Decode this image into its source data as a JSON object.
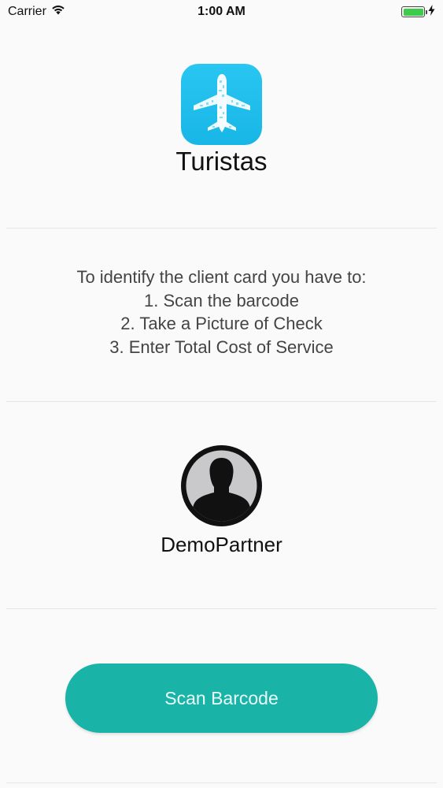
{
  "status_bar": {
    "carrier": "Carrier",
    "time": "1:00 AM"
  },
  "header": {
    "app_icon": "airplane-icon",
    "title": "Turistas"
  },
  "instructions": {
    "lines": [
      "To identify the client card you have to:",
      "1. Scan the barcode",
      "2. Take a Picture of Check",
      "3. Enter Total Cost of Service"
    ]
  },
  "partner": {
    "avatar_icon": "person-silhouette-icon",
    "name": "DemoPartner"
  },
  "actions": {
    "scan_label": "Scan Barcode"
  },
  "colors": {
    "accent": "#1ab3a8",
    "app_icon": "#29c6f2",
    "battery": "#3ecb4b"
  }
}
